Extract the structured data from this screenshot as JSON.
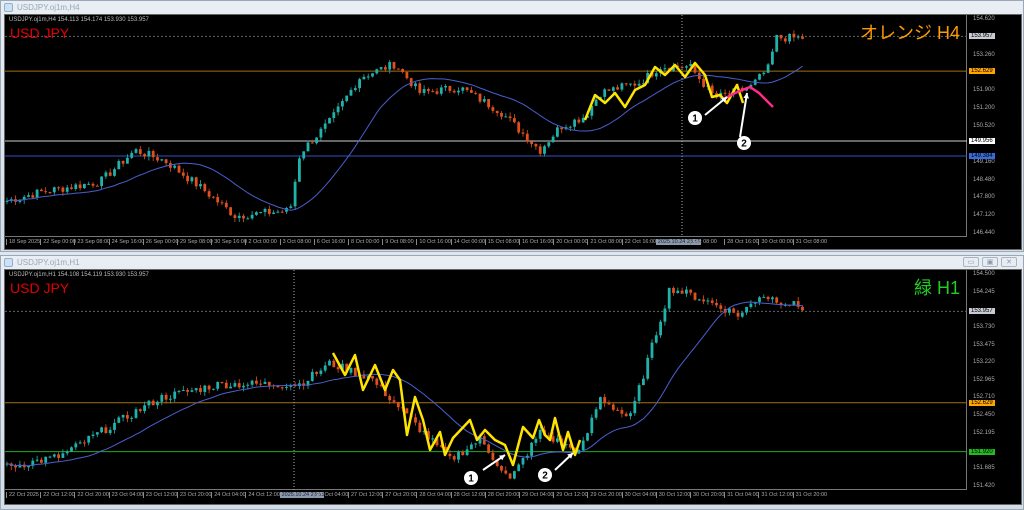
{
  "top": {
    "window_title": "USDJPY.oj1m,H4",
    "ohlc_line": "USDJPY.oj1m,H4  154.113 154.174 153.930 153.957",
    "symbol_label": "USD JPY",
    "timeframe_label": "オレンジ H4",
    "timeframe_color": "#ff9a00",
    "price_max": 154.62,
    "price_min": 146.44,
    "price_labels": [
      "154.620",
      "153.260",
      "151.900",
      "151.200",
      "150.520",
      "149.160",
      "148.480",
      "147.800",
      "147.120",
      "146.440"
    ],
    "price_boxes": [
      {
        "text": "153.957",
        "value": 153.957,
        "bg": "#c8ccd2",
        "line": "#666"
      },
      {
        "text": "152.629",
        "value": 152.629,
        "bg": "#ffa500",
        "line": "#a07010"
      },
      {
        "text": "149.956",
        "value": 149.956,
        "bg": "#ffffff",
        "line": "#cccccc"
      },
      {
        "text": "149.384",
        "value": 149.384,
        "bg": "#3a6cd8",
        "line": "#3050c0"
      }
    ],
    "x_labels": [
      "18 Sep 2025",
      "22 Sep 00:00",
      "23 Sep 08:00",
      "24 Sep 16:00",
      "26 Sep 00:00",
      "29 Sep 08:00",
      "30 Sep 16:00",
      "2 Oct 00:00",
      "3 Oct 08:00",
      "6 Oct 16:00",
      "8 Oct 00:00",
      "9 Oct 08:00",
      "10 Oct 16:00",
      "14 Oct 00:00",
      "15 Oct 08:00",
      "16 Oct 16:00",
      "20 Oct 00:00",
      "21 Oct 08:00",
      "22 Oct 16:00",
      "2025.10.24 23:55",
      "Oct 08:00",
      "28 Oct 16:00",
      "30 Oct 00:00",
      "31 Oct 08:00"
    ],
    "cursor_label_index": 19,
    "price_path": [
      [
        0,
        147.65
      ],
      [
        35,
        148.0
      ],
      [
        95,
        148.4
      ],
      [
        130,
        149.6
      ],
      [
        160,
        149.2
      ],
      [
        195,
        148.2
      ],
      [
        230,
        147.1
      ],
      [
        285,
        147.3
      ],
      [
        295,
        149.5
      ],
      [
        325,
        150.7
      ],
      [
        355,
        152.4
      ],
      [
        390,
        152.9
      ],
      [
        415,
        151.8
      ],
      [
        455,
        152.0
      ],
      [
        495,
        151.1
      ],
      [
        535,
        149.6
      ],
      [
        555,
        150.5
      ],
      [
        580,
        150.9
      ],
      [
        595,
        151.8
      ],
      [
        635,
        152.2
      ],
      [
        655,
        152.8
      ],
      [
        685,
        152.8
      ],
      [
        710,
        151.6
      ],
      [
        745,
        152.0
      ],
      [
        765,
        152.8
      ],
      [
        770,
        153.9
      ],
      [
        800,
        153.9
      ]
    ],
    "annotations": [
      "1",
      "2"
    ]
  },
  "bottom": {
    "window_title": "USDJPY.oj1m,H1",
    "ohlc_line": "USDJPY.oj1m,H1  154.108 154.119 153.930 153.957",
    "symbol_label": "USD JPY",
    "timeframe_label": "緑 H1",
    "timeframe_color": "#22cc22",
    "price_max": 154.5,
    "price_min": 151.42,
    "price_labels": [
      "154.500",
      "154.245",
      "153.730",
      "153.475",
      "153.220",
      "152.965",
      "152.710",
      "152.450",
      "152.195",
      "151.685",
      "151.420"
    ],
    "price_boxes": [
      {
        "text": "153.957",
        "value": 153.957,
        "bg": "#c8ccd2",
        "line": "#666"
      },
      {
        "text": "152.629",
        "value": 152.629,
        "bg": "#ffa500",
        "line": "#a07010"
      },
      {
        "text": "151.920",
        "value": 151.92,
        "bg": "#22bb22",
        "line": "#22aa22"
      }
    ],
    "x_labels": [
      "22 Oct 2025",
      "22 Oct 12:00",
      "22 Oct 20:00",
      "23 Oct 04:00",
      "23 Oct 12:00",
      "23 Oct 20:00",
      "24 Oct 04:00",
      "24 Oct 12:00",
      "2025.10.24 23:55",
      "27 Oct 04:00",
      "27 Oct 12:00",
      "27 Oct 20:00",
      "28 Oct 04:00",
      "28 Oct 12:00",
      "28 Oct 20:00",
      "29 Oct 04:00",
      "29 Oct 12:00",
      "29 Oct 20:00",
      "30 Oct 04:00",
      "30 Oct 12:00",
      "30 Oct 20:00",
      "31 Oct 04:00",
      "31 Oct 12:00",
      "31 Oct 20:00"
    ],
    "cursor_label_index": 8,
    "price_path": [
      [
        0,
        151.69
      ],
      [
        55,
        151.85
      ],
      [
        95,
        152.2
      ],
      [
        155,
        152.7
      ],
      [
        215,
        152.9
      ],
      [
        295,
        152.9
      ],
      [
        325,
        153.2
      ],
      [
        365,
        153.0
      ],
      [
        405,
        152.4
      ],
      [
        445,
        151.8
      ],
      [
        475,
        152.1
      ],
      [
        505,
        151.5
      ],
      [
        535,
        152.2
      ],
      [
        575,
        151.9
      ],
      [
        595,
        152.7
      ],
      [
        625,
        152.4
      ],
      [
        665,
        154.3
      ],
      [
        695,
        154.15
      ],
      [
        735,
        153.9
      ],
      [
        755,
        154.2
      ],
      [
        800,
        154.0
      ]
    ],
    "annotations": [
      "1",
      "2"
    ]
  },
  "colors": {
    "bull": "#20b2aa",
    "bear": "#e0501e",
    "ma": "#4a5fd0"
  }
}
